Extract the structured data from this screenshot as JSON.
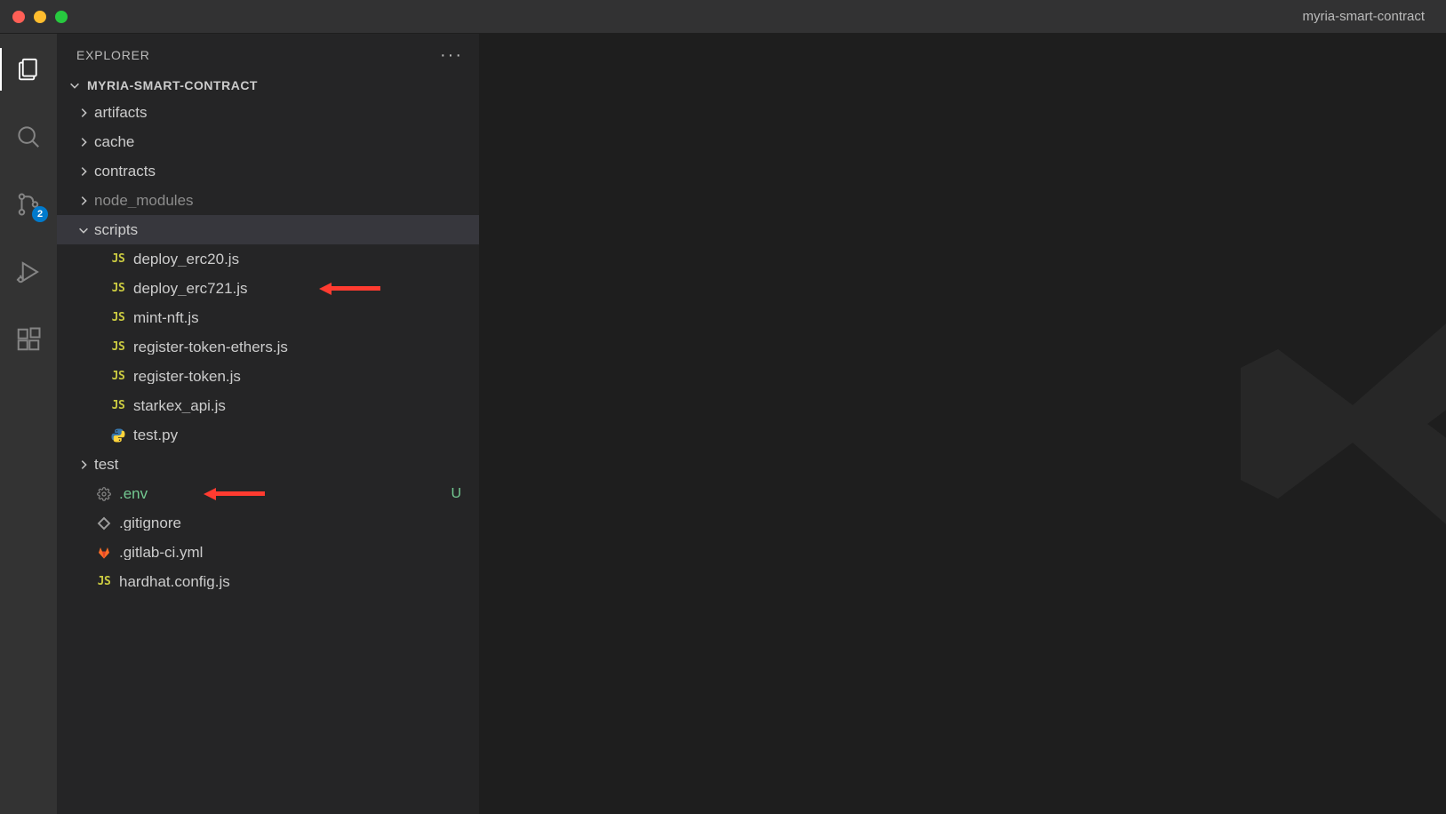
{
  "window": {
    "title": "myria-smart-contract"
  },
  "activity_bar": {
    "scm_badge": "2"
  },
  "sidebar": {
    "title": "Explorer",
    "project_name": "MYRIA-SMART-CONTRACT"
  },
  "tree": {
    "folders_top": [
      {
        "name": "artifacts",
        "dim": false
      },
      {
        "name": "cache",
        "dim": false
      },
      {
        "name": "contracts",
        "dim": false
      },
      {
        "name": "node_modules",
        "dim": true
      }
    ],
    "scripts_folder": "scripts",
    "scripts": [
      {
        "name": "deploy_erc20.js",
        "icon": "js"
      },
      {
        "name": "deploy_erc721.js",
        "icon": "js"
      },
      {
        "name": "mint-nft.js",
        "icon": "js"
      },
      {
        "name": "register-token-ethers.js",
        "icon": "js"
      },
      {
        "name": "register-token.js",
        "icon": "js"
      },
      {
        "name": "starkex_api.js",
        "icon": "js"
      },
      {
        "name": "test.py",
        "icon": "py"
      }
    ],
    "test_folder": "test",
    "files_bottom": [
      {
        "name": ".env",
        "icon": "gear",
        "green": true,
        "status": "U"
      },
      {
        "name": ".gitignore",
        "icon": "git",
        "green": false,
        "status": ""
      },
      {
        "name": ".gitlab-ci.yml",
        "icon": "gitlab",
        "green": false,
        "status": ""
      },
      {
        "name": "hardhat.config.js",
        "icon": "js",
        "green": false,
        "status": ""
      }
    ]
  }
}
